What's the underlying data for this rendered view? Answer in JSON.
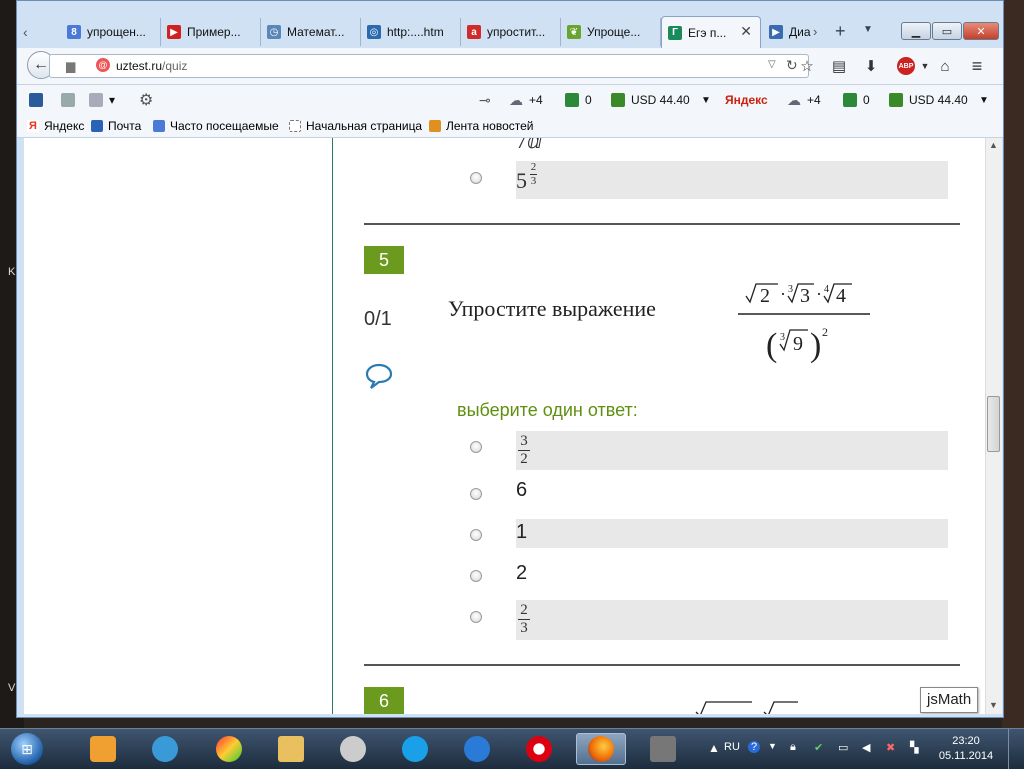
{
  "tabs": [
    {
      "label": "упрощен...",
      "icon": "google-icon",
      "color": "#4a7ad8"
    },
    {
      "label": "Пример...",
      "icon": "youtube-icon",
      "color": "#d02020"
    },
    {
      "label": "Математ...",
      "icon": "clock-icon",
      "color": "#5a86b8"
    },
    {
      "label": "http:....htm",
      "icon": "globe-icon",
      "color": "#2a6bb0"
    },
    {
      "label": "упростит...",
      "icon": "ask-icon",
      "color": "#d02a2a"
    },
    {
      "label": "Упроще...",
      "icon": "leaf-icon",
      "color": "#6aa430"
    },
    {
      "label": "Егэ п...",
      "icon": "ege-icon",
      "color": "#1b8a5a",
      "active": true
    },
    {
      "label": "Диа",
      "icon": "play-icon",
      "color": "#3a6ab0"
    }
  ],
  "nav": {
    "url_host": "uztest.ru",
    "url_path": "/quiz"
  },
  "toolbar": {
    "temp": "+4",
    "zero": "0",
    "usd": "USD 44.40",
    "yandex": "Яндекс",
    "temp2": "+4",
    "zero2": "0",
    "usd2": "USD 44.40"
  },
  "bookmarks": [
    {
      "label": "Яндекс",
      "icon": "yandex-icon",
      "color": "#e32"
    },
    {
      "label": "Почта",
      "icon": "mail-icon",
      "color": "#2a62b8"
    },
    {
      "label": "Часто посещаемые",
      "icon": "search-icon",
      "color": "#4a7ad8"
    },
    {
      "label": "Начальная страница",
      "icon": "page-icon",
      "color": "#fff"
    },
    {
      "label": "Лента новостей",
      "icon": "rss-icon",
      "color": "#e09020"
    }
  ],
  "quiz": {
    "prev_option_base": "5",
    "prev_option_exp_num": "2",
    "prev_option_exp_den": "3",
    "q5": {
      "number": "5",
      "score": "0/1",
      "prompt": "Упростите выражение",
      "instruction": "выберите один ответ:",
      "options": [
        {
          "num": "3",
          "den": "2"
        },
        {
          "text": "6"
        },
        {
          "text": "1"
        },
        {
          "text": "2"
        },
        {
          "num": "2",
          "den": "3"
        }
      ]
    },
    "q6": {
      "number": "6"
    },
    "jsmath": "jsMath"
  },
  "taskbar": {
    "lang": "RU",
    "time": "23:20",
    "date": "05.11.2014"
  }
}
